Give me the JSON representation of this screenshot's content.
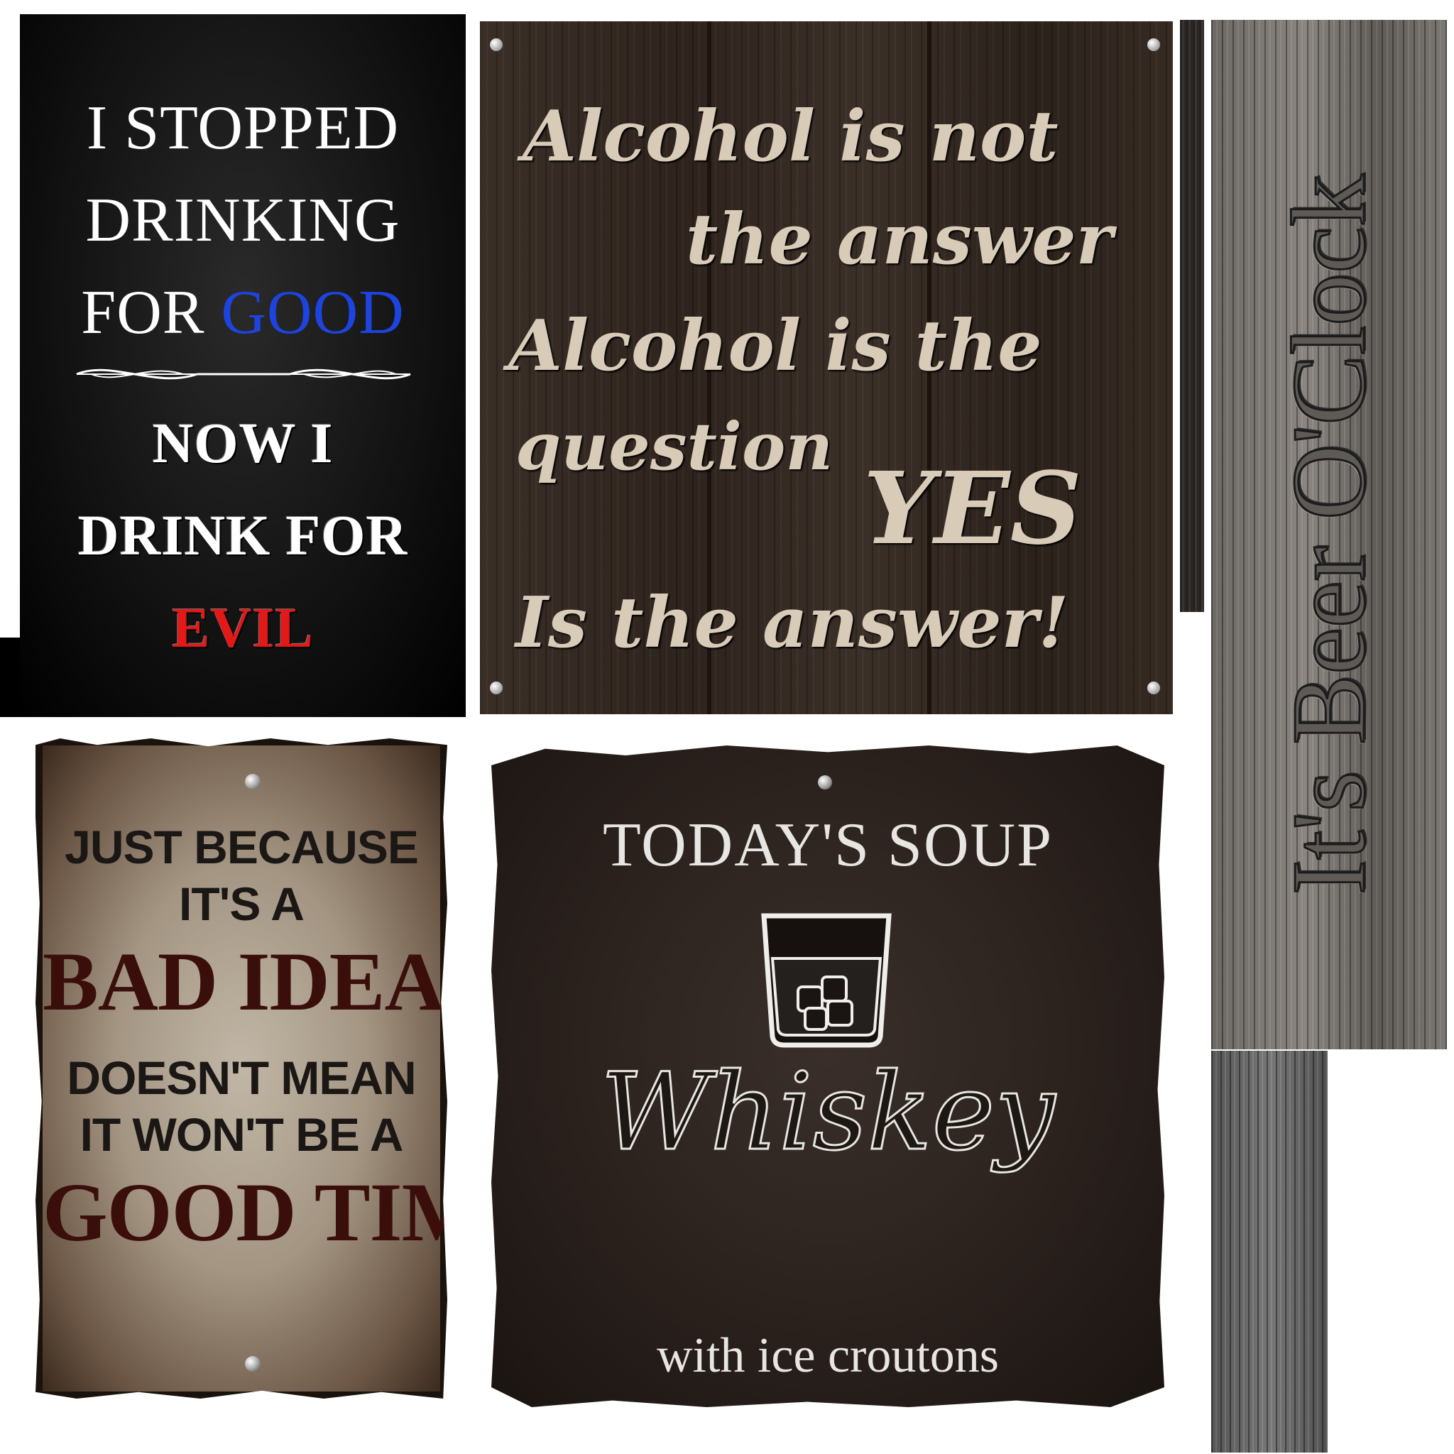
{
  "sign_black": {
    "line1": "I STOPPED",
    "line2": "DRINKING",
    "line3_prefix": "FOR ",
    "line3_highlight": "GOOD",
    "line4": "NOW I",
    "line5": "DRINK FOR",
    "line6": "EVIL",
    "colors": {
      "good": "#1e44e0",
      "evil": "#e31818"
    }
  },
  "sign_wood": {
    "line1": "Alcohol is not",
    "line2": "the answer",
    "line3": "Alcohol is the",
    "line4": "question",
    "line5": "YES",
    "line6": "Is the answer!"
  },
  "sign_beer": {
    "text": "It's Beer O'Clock"
  },
  "sign_parchment": {
    "line1": "JUST BECAUSE",
    "line2": "IT'S A",
    "line3": "BAD IDEA",
    "line4": "DOESN'T MEAN",
    "line5": "IT WON'T BE A",
    "line6": "GOOD TIME"
  },
  "sign_soup": {
    "title": "TODAY'S SOUP",
    "glass_icon": "whiskey-glass-icon",
    "main": "Whiskey",
    "subtitle": "with ice croutons"
  }
}
